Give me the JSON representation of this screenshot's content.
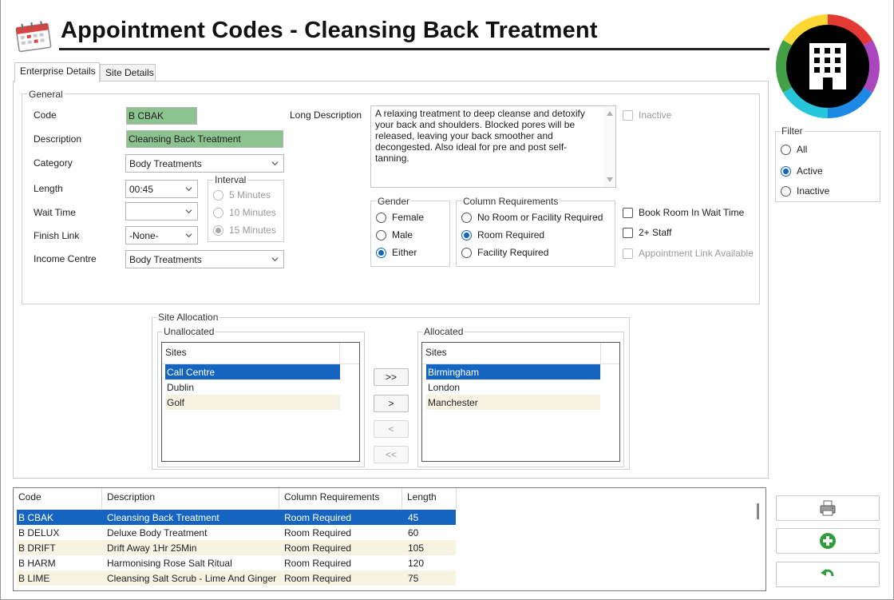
{
  "header": {
    "title": "Appointment Codes - Cleansing Back Treatment"
  },
  "tabs": [
    {
      "label": "Enterprise Details",
      "active": true
    },
    {
      "label": "Site Details",
      "active": false
    }
  ],
  "general": {
    "legend": "General",
    "code_label": "Code",
    "code_value": "B CBAK",
    "description_label": "Description",
    "description_value": "Cleansing Back Treatment",
    "category_label": "Category",
    "category_value": "Body Treatments",
    "length_label": "Length",
    "length_value": "00:45",
    "wait_time_label": "Wait Time",
    "wait_time_value": "",
    "finish_link_label": "Finish Link",
    "finish_link_value": "-None-",
    "income_centre_label": "Income Centre",
    "income_centre_value": "Body Treatments",
    "interval": {
      "legend": "Interval",
      "options": [
        "5 Minutes",
        "10 Minutes",
        "15 Minutes"
      ],
      "selected": "15 Minutes"
    },
    "long_description_label": "Long Description",
    "long_description_value": "A relaxing treatment to deep cleanse and detoxify your back and shoulders. Blocked pores will be released, leaving your back smoother and decongested. Also ideal for pre and post self-tanning.",
    "inactive_label": "Inactive",
    "gender": {
      "legend": "Gender",
      "options": [
        "Female",
        "Male",
        "Either"
      ],
      "selected": "Either"
    },
    "column_requirements": {
      "legend": "Column Requirements",
      "options": [
        "No Room or Facility Required",
        "Room Required",
        "Facility Required"
      ],
      "selected": "Room Required"
    },
    "book_room_label": "Book Room In Wait Time",
    "two_staff_label": "2+ Staff",
    "appointment_link_label": "Appointment Link Available"
  },
  "site_allocation": {
    "legend": "Site Allocation",
    "unallocated": {
      "legend": "Unallocated",
      "header": "Sites",
      "items": [
        "Call Centre",
        "Dublin",
        "Golf"
      ]
    },
    "allocated": {
      "legend": "Allocated",
      "header": "Sites",
      "items": [
        "Birmingham",
        "London",
        "Manchester"
      ]
    },
    "buttons": [
      ">>",
      ">",
      "<",
      "<<"
    ]
  },
  "filter": {
    "legend": "Filter",
    "options": [
      "All",
      "Active",
      "Inactive"
    ],
    "selected": "Active"
  },
  "grid": {
    "columns": [
      "Code",
      "Description",
      "Column Requirements",
      "Length"
    ],
    "rows": [
      [
        "B CBAK",
        "Cleansing Back Treatment",
        "Room Required",
        "45"
      ],
      [
        "B DELUX",
        "Deluxe Body Treatment",
        "Room Required",
        "60"
      ],
      [
        "B DRIFT",
        "Drift Away 1Hr 25Min",
        "Room Required",
        "105"
      ],
      [
        "B HARM",
        "Harmonising Rose Salt Ritual",
        "Room Required",
        "120"
      ],
      [
        "B LIME",
        "Cleansing Salt Scrub - Lime And Ginger",
        "Room Required",
        "75"
      ]
    ]
  },
  "side_buttons": [
    "printer-icon",
    "add-icon",
    "undo-icon"
  ],
  "colors": {
    "accent": "#1565c0",
    "required_field": "#8cc38e",
    "alt_row": "#f6f3e2"
  }
}
